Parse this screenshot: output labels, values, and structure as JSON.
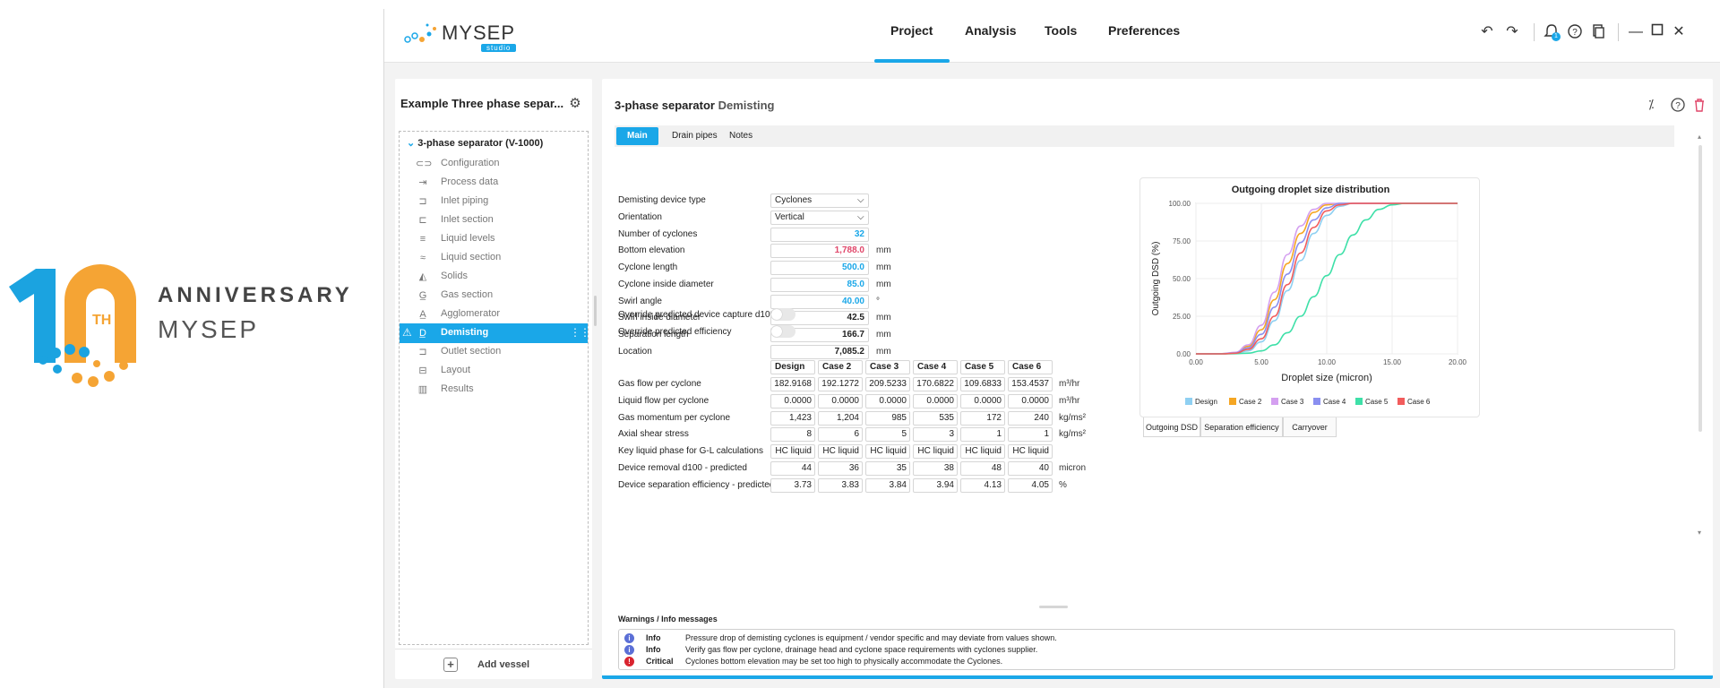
{
  "anniversary": {
    "number": "10",
    "suffix": "TH",
    "line1": "ANNIVERSARY",
    "line2": "MYSEP"
  },
  "app": {
    "logo_text": "MYSEP",
    "logo_sub": "studio",
    "menu": [
      "Project",
      "Analysis",
      "Tools",
      "Preferences"
    ],
    "notification_count": "1",
    "accent": "#1aa7e8"
  },
  "sidebar": {
    "project_title": "Example Three phase separ...",
    "root": "3-phase separator (V-1000)",
    "items": [
      {
        "label": "Configuration",
        "icon": "configuration-icon"
      },
      {
        "label": "Process data",
        "icon": "process-data-icon"
      },
      {
        "label": "Inlet piping",
        "icon": "inlet-piping-icon"
      },
      {
        "label": "Inlet section",
        "icon": "inlet-section-icon"
      },
      {
        "label": "Liquid levels",
        "icon": "liquid-levels-icon"
      },
      {
        "label": "Liquid section",
        "icon": "liquid-section-icon"
      },
      {
        "label": "Solids",
        "icon": "solids-icon"
      },
      {
        "label": "Gas section",
        "icon": "gas-section-icon"
      },
      {
        "label": "Agglomerator",
        "icon": "agglomerator-icon"
      },
      {
        "label": "Demisting",
        "icon": "demisting-icon"
      },
      {
        "label": "Outlet section",
        "icon": "outlet-section-icon"
      },
      {
        "label": "Layout",
        "icon": "layout-icon"
      },
      {
        "label": "Results",
        "icon": "results-icon"
      }
    ],
    "active_index": 9,
    "add_vessel": "Add vessel"
  },
  "panel": {
    "title": "3-phase separator",
    "subtitle": "Demisting",
    "tabs": [
      "Main",
      "Drain pipes",
      "Notes"
    ],
    "fields": [
      {
        "label": "Demisting device type",
        "value": "Cyclones",
        "type": "select",
        "unit": ""
      },
      {
        "label": "Orientation",
        "value": "Vertical",
        "type": "select",
        "unit": ""
      },
      {
        "label": "Number of cyclones",
        "value": "32",
        "type": "blue",
        "unit": ""
      },
      {
        "label": "Bottom elevation",
        "value": "1,788.0",
        "type": "red",
        "unit": "mm"
      },
      {
        "label": "Cyclone length",
        "value": "500.0",
        "type": "blue",
        "unit": "mm"
      },
      {
        "label": "Cyclone inside diameter",
        "value": "85.0",
        "type": "blue",
        "unit": "mm"
      },
      {
        "label": "Swirl angle",
        "value": "40.00",
        "type": "blue",
        "unit": "°"
      },
      {
        "label": "Swirl inside diameter",
        "value": "42.5",
        "type": "plain",
        "unit": "mm"
      },
      {
        "label": "Separation length",
        "value": "166.7",
        "type": "plain",
        "unit": "mm"
      },
      {
        "label": "Location",
        "value": "7,085.2",
        "type": "plain",
        "unit": "mm"
      }
    ],
    "toggles": [
      "Override predicted device capture d100",
      "Override predicted efficiency"
    ],
    "table": {
      "headers": [
        "Design",
        "Case 2",
        "Case 3",
        "Case 4",
        "Case 5",
        "Case 6"
      ],
      "rows": [
        {
          "label": "Gas flow per cyclone",
          "values": [
            "182.9168",
            "192.1272",
            "209.5233",
            "170.6822",
            "109.6833",
            "153.4537"
          ],
          "unit": "m³/hr"
        },
        {
          "label": "Liquid flow per cyclone",
          "values": [
            "0.0000",
            "0.0000",
            "0.0000",
            "0.0000",
            "0.0000",
            "0.0000"
          ],
          "unit": "m³/hr"
        },
        {
          "label": "Gas momentum per cyclone",
          "values": [
            "1,423",
            "1,204",
            "985",
            "535",
            "172",
            "240"
          ],
          "unit": "kg/ms²"
        },
        {
          "label": "Axial shear stress",
          "values": [
            "8",
            "6",
            "5",
            "3",
            "1",
            "1"
          ],
          "unit": "kg/ms²"
        },
        {
          "label": "Key liquid phase for G-L calculations",
          "values": [
            "HC liquid",
            "HC liquid",
            "HC liquid",
            "HC liquid",
            "HC liquid",
            "HC liquid"
          ],
          "unit": ""
        },
        {
          "label": "Device removal d100 - predicted",
          "values": [
            "44",
            "36",
            "35",
            "38",
            "48",
            "40"
          ],
          "unit": "micron"
        },
        {
          "label": "Device separation efficiency - predicted",
          "values": [
            "3.73",
            "3.83",
            "3.84",
            "3.94",
            "4.13",
            "4.05"
          ],
          "unit": "%"
        }
      ]
    },
    "warnings_title": "Warnings / Info messages",
    "warnings": [
      {
        "level": "Info",
        "text": "Pressure drop of demisting cyclones is equipment / vendor specific and may deviate from values shown.",
        "color": "#5b6fd6"
      },
      {
        "level": "Info",
        "text": "Verify gas flow per cyclone, drainage head and cyclone space requirements with cyclones supplier.",
        "color": "#5b6fd6"
      },
      {
        "level": "Critical",
        "text": "Cyclones bottom elevation may be set too high to physically accommodate the Cyclones.",
        "color": "#d9242f"
      }
    ],
    "chart_tabs": [
      "Outgoing DSD",
      "Separation efficiency",
      "Carryover"
    ]
  },
  "chart_data": {
    "type": "line",
    "title": "Outgoing droplet size distribution",
    "xlabel": "Droplet size (micron)",
    "ylabel": "Outgoing DSD (%)",
    "xlim": [
      0,
      20
    ],
    "ylim": [
      0,
      100
    ],
    "xticks": [
      "0.00",
      "5.00",
      "10.00",
      "15.00",
      "20.00"
    ],
    "yticks": [
      "0.00",
      "25.00",
      "50.00",
      "75.00",
      "100.00"
    ],
    "legend_position": "bottom",
    "x": [
      0,
      2,
      3,
      4,
      5,
      6,
      7,
      8,
      9,
      10,
      11,
      12,
      13,
      14,
      15,
      16,
      17,
      18,
      20
    ],
    "series": [
      {
        "name": "Design",
        "color": "#8fd0f2",
        "values": [
          0,
          0,
          0.3,
          2,
          8,
          22,
          42,
          62,
          80,
          92,
          98,
          100,
          100,
          100,
          100,
          100,
          100,
          100,
          100
        ]
      },
      {
        "name": "Case 2",
        "color": "#f5a623",
        "values": [
          0,
          0.1,
          0.8,
          5,
          16,
          36,
          60,
          80,
          94,
          99,
          100,
          100,
          100,
          100,
          100,
          100,
          100,
          100,
          100
        ]
      },
      {
        "name": "Case 3",
        "color": "#d49ff0",
        "values": [
          0,
          0.1,
          1,
          6,
          19,
          41,
          66,
          85,
          96,
          100,
          100,
          100,
          100,
          100,
          100,
          100,
          100,
          100,
          100
        ]
      },
      {
        "name": "Case 4",
        "color": "#8a8ff0",
        "values": [
          0,
          0.1,
          0.6,
          4,
          13,
          31,
          53,
          74,
          89,
          97,
          100,
          100,
          100,
          100,
          100,
          100,
          100,
          100,
          100
        ]
      },
      {
        "name": "Case 5",
        "color": "#3ee0a8",
        "values": [
          0,
          0,
          0.1,
          0.5,
          2,
          6,
          14,
          25,
          38,
          52,
          66,
          79,
          89,
          96,
          99,
          100,
          100,
          100,
          100
        ]
      },
      {
        "name": "Case 6",
        "color": "#f25c5c",
        "values": [
          0,
          0,
          0.4,
          3,
          10,
          25,
          46,
          67,
          84,
          95,
          99,
          100,
          100,
          100,
          100,
          100,
          100,
          100,
          100
        ]
      }
    ]
  }
}
